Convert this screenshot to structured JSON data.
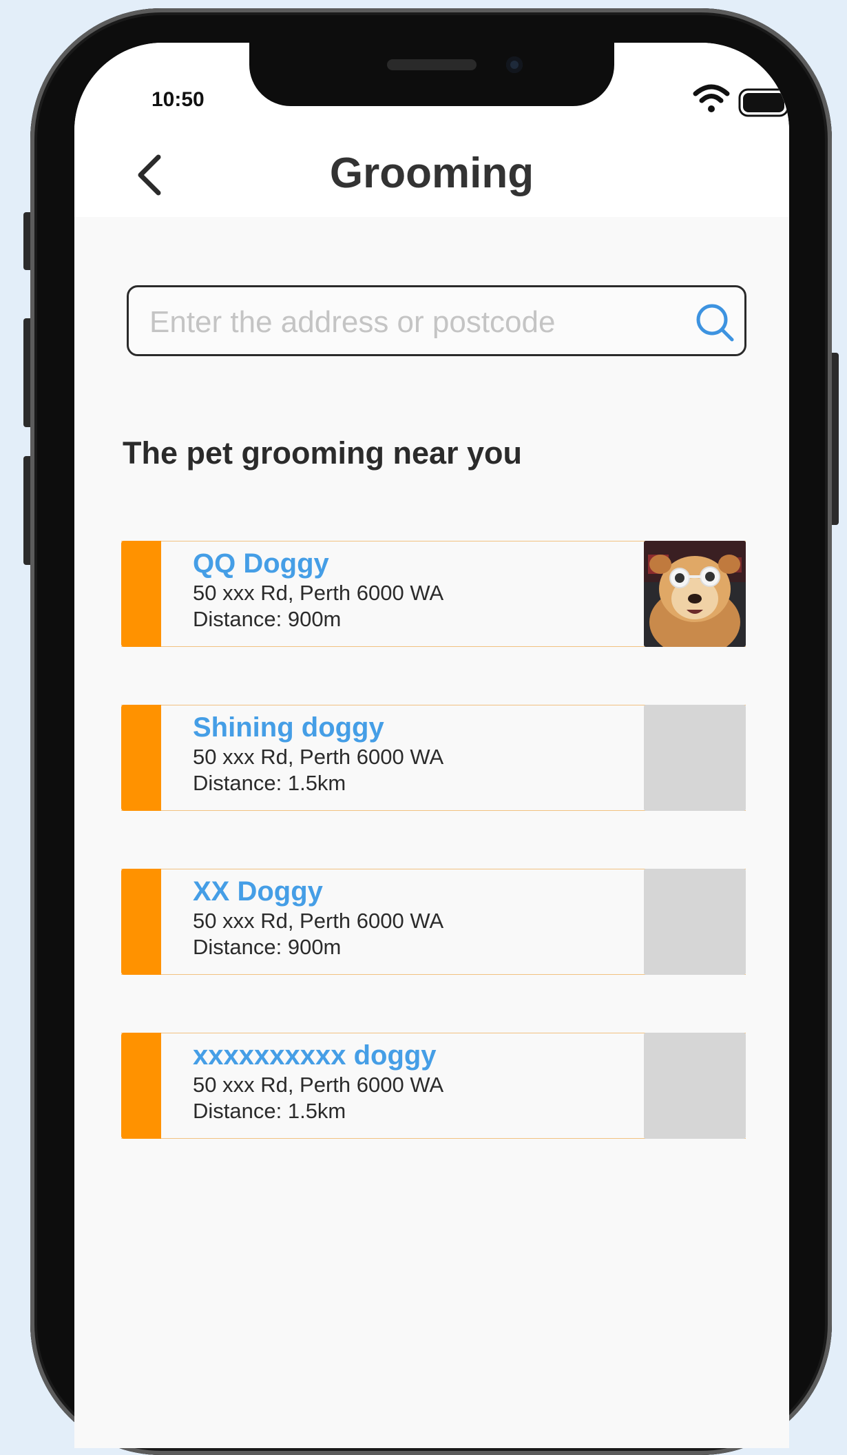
{
  "status_bar": {
    "time": "10:50"
  },
  "header": {
    "title": "Grooming",
    "back_icon": "chevron-left-icon"
  },
  "search": {
    "value": "",
    "placeholder": "Enter the address or postcode",
    "icon": "search-icon"
  },
  "section": {
    "title": "The pet grooming near you"
  },
  "colors": {
    "accent": "#ff9200",
    "link_blue": "#459ee6",
    "thumb_placeholder": "#d6d6d6"
  },
  "groomers": [
    {
      "name": "QQ Doggy",
      "address": "50 xxx Rd, Perth 6000 WA",
      "distance": "Distance: 900m",
      "image": "dog-photo"
    },
    {
      "name": "Shining doggy",
      "address": "50 xxx Rd, Perth 6000 WA",
      "distance": "Distance: 1.5km",
      "image": "placeholder"
    },
    {
      "name": "XX Doggy",
      "address": "50 xxx Rd, Perth 6000 WA",
      "distance": "Distance: 900m",
      "image": "placeholder"
    },
    {
      "name": "xxxxxxxxxx doggy",
      "address": "50 xxx Rd, Perth 6000 WA",
      "distance": "Distance: 1.5km",
      "image": "placeholder"
    }
  ]
}
